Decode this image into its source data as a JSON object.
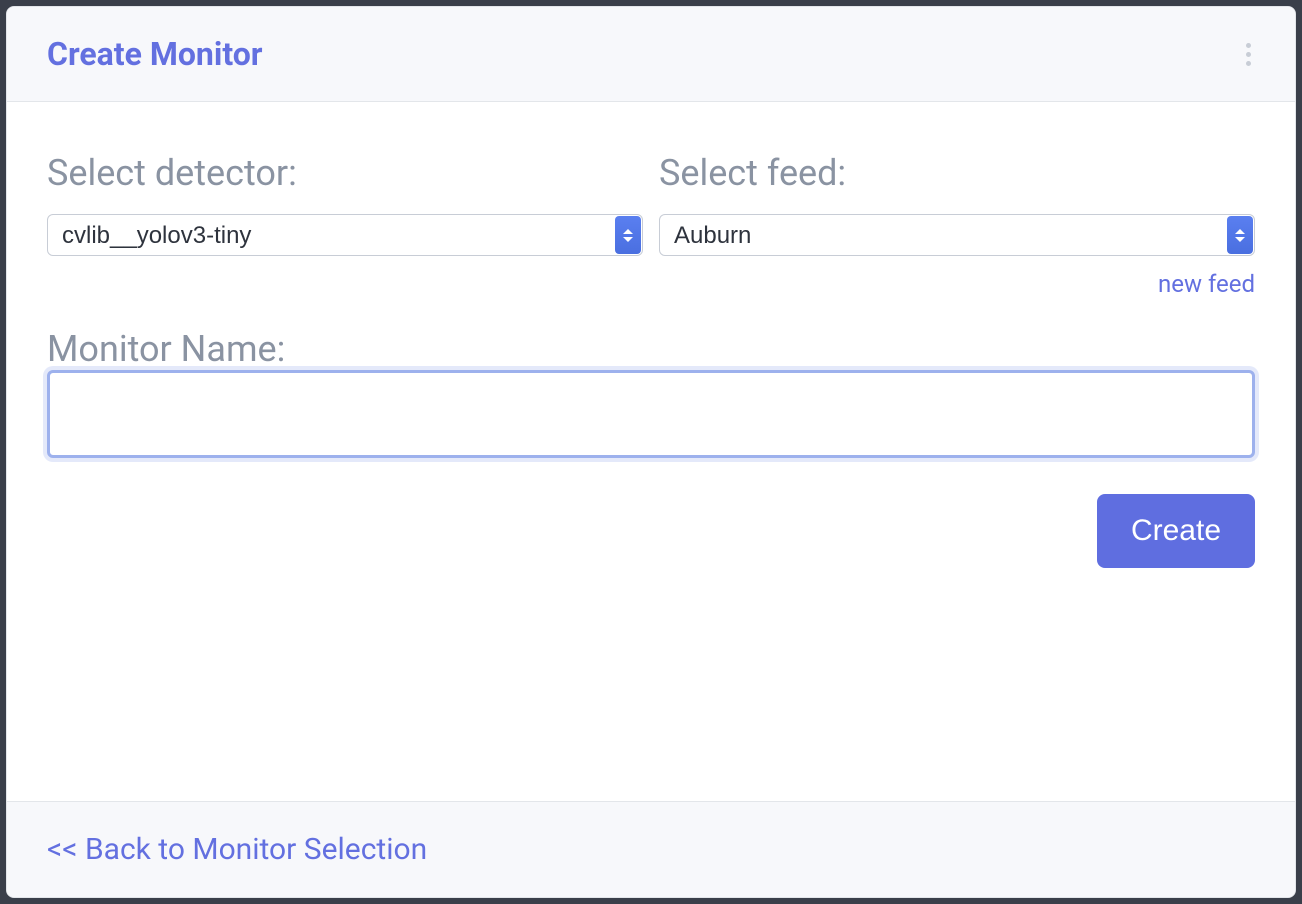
{
  "header": {
    "title": "Create Monitor"
  },
  "form": {
    "detector": {
      "label": "Select detector:",
      "value": "cvlib__yolov3-tiny"
    },
    "feed": {
      "label": "Select feed:",
      "value": "Auburn",
      "new_link": "new feed"
    },
    "monitor_name": {
      "label": "Monitor Name:",
      "value": ""
    },
    "create_button": "Create"
  },
  "footer": {
    "back_link": "<< Back to Monitor Selection"
  }
}
